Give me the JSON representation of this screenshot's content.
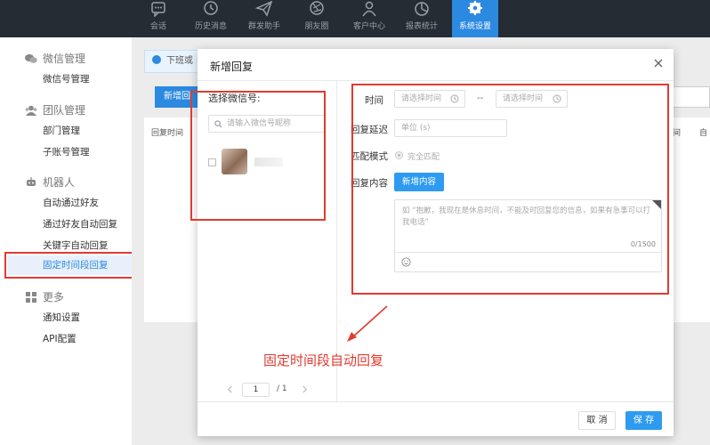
{
  "nav": [
    {
      "label": "会话",
      "icon": "chat-icon"
    },
    {
      "label": "历史消息",
      "icon": "clock-icon"
    },
    {
      "label": "群发助手",
      "icon": "send-icon"
    },
    {
      "label": "朋友圈",
      "icon": "aperture-icon"
    },
    {
      "label": "客户中心",
      "icon": "user-icon"
    },
    {
      "label": "报表统计",
      "icon": "pie-chart-icon"
    },
    {
      "label": "系统设置",
      "icon": "gear-icon",
      "active": true
    }
  ],
  "sidebar": {
    "wechat_title": "微信管理",
    "wechat_accounts": "微信号管理",
    "team_title": "团队管理",
    "department": "部门管理",
    "sub_accounts": "子账号管理",
    "robot_title": "机器人",
    "auto_accept": "自动通过好友",
    "accept_reply": "通过好友自动回复",
    "keyword_reply": "关键字自动回复",
    "timed_reply": "固定时间段回复",
    "more_title": "更多",
    "notify": "通知设置",
    "api": "API配置"
  },
  "background": {
    "notice": "下班或",
    "add_button": "新增回",
    "col_reply_time": "回复时间",
    "col_right_1": "间",
    "col_right_2": "自"
  },
  "dialog": {
    "title": "新增回复",
    "select_account_label": "选择微信号:",
    "search_placeholder": "请输入微信号昵称",
    "page_current": "1",
    "page_total": "/ 1",
    "time_label": "时间",
    "time_start_placeholder": "请选择时间",
    "time_separator": "--",
    "time_end_placeholder": "请选择时间",
    "delay_label": "回复延迟",
    "delay_placeholder": "单位 (s)",
    "match_label": "匹配模式",
    "match_option": "完全匹配",
    "content_label": "回复内容",
    "add_content_button": "新增内容",
    "content_placeholder": "如 “抱歉，我现在是休息时间，不能及时回复您的信息，如果有急事可以打我电话”",
    "char_count": "0/1500",
    "cancel": "取 消",
    "save": "保 存"
  },
  "annotation": "固定时间段自动回复",
  "colors": {
    "accent": "#2b89e0",
    "annotation_red": "#e03c31",
    "nav_bg": "#262c33"
  }
}
